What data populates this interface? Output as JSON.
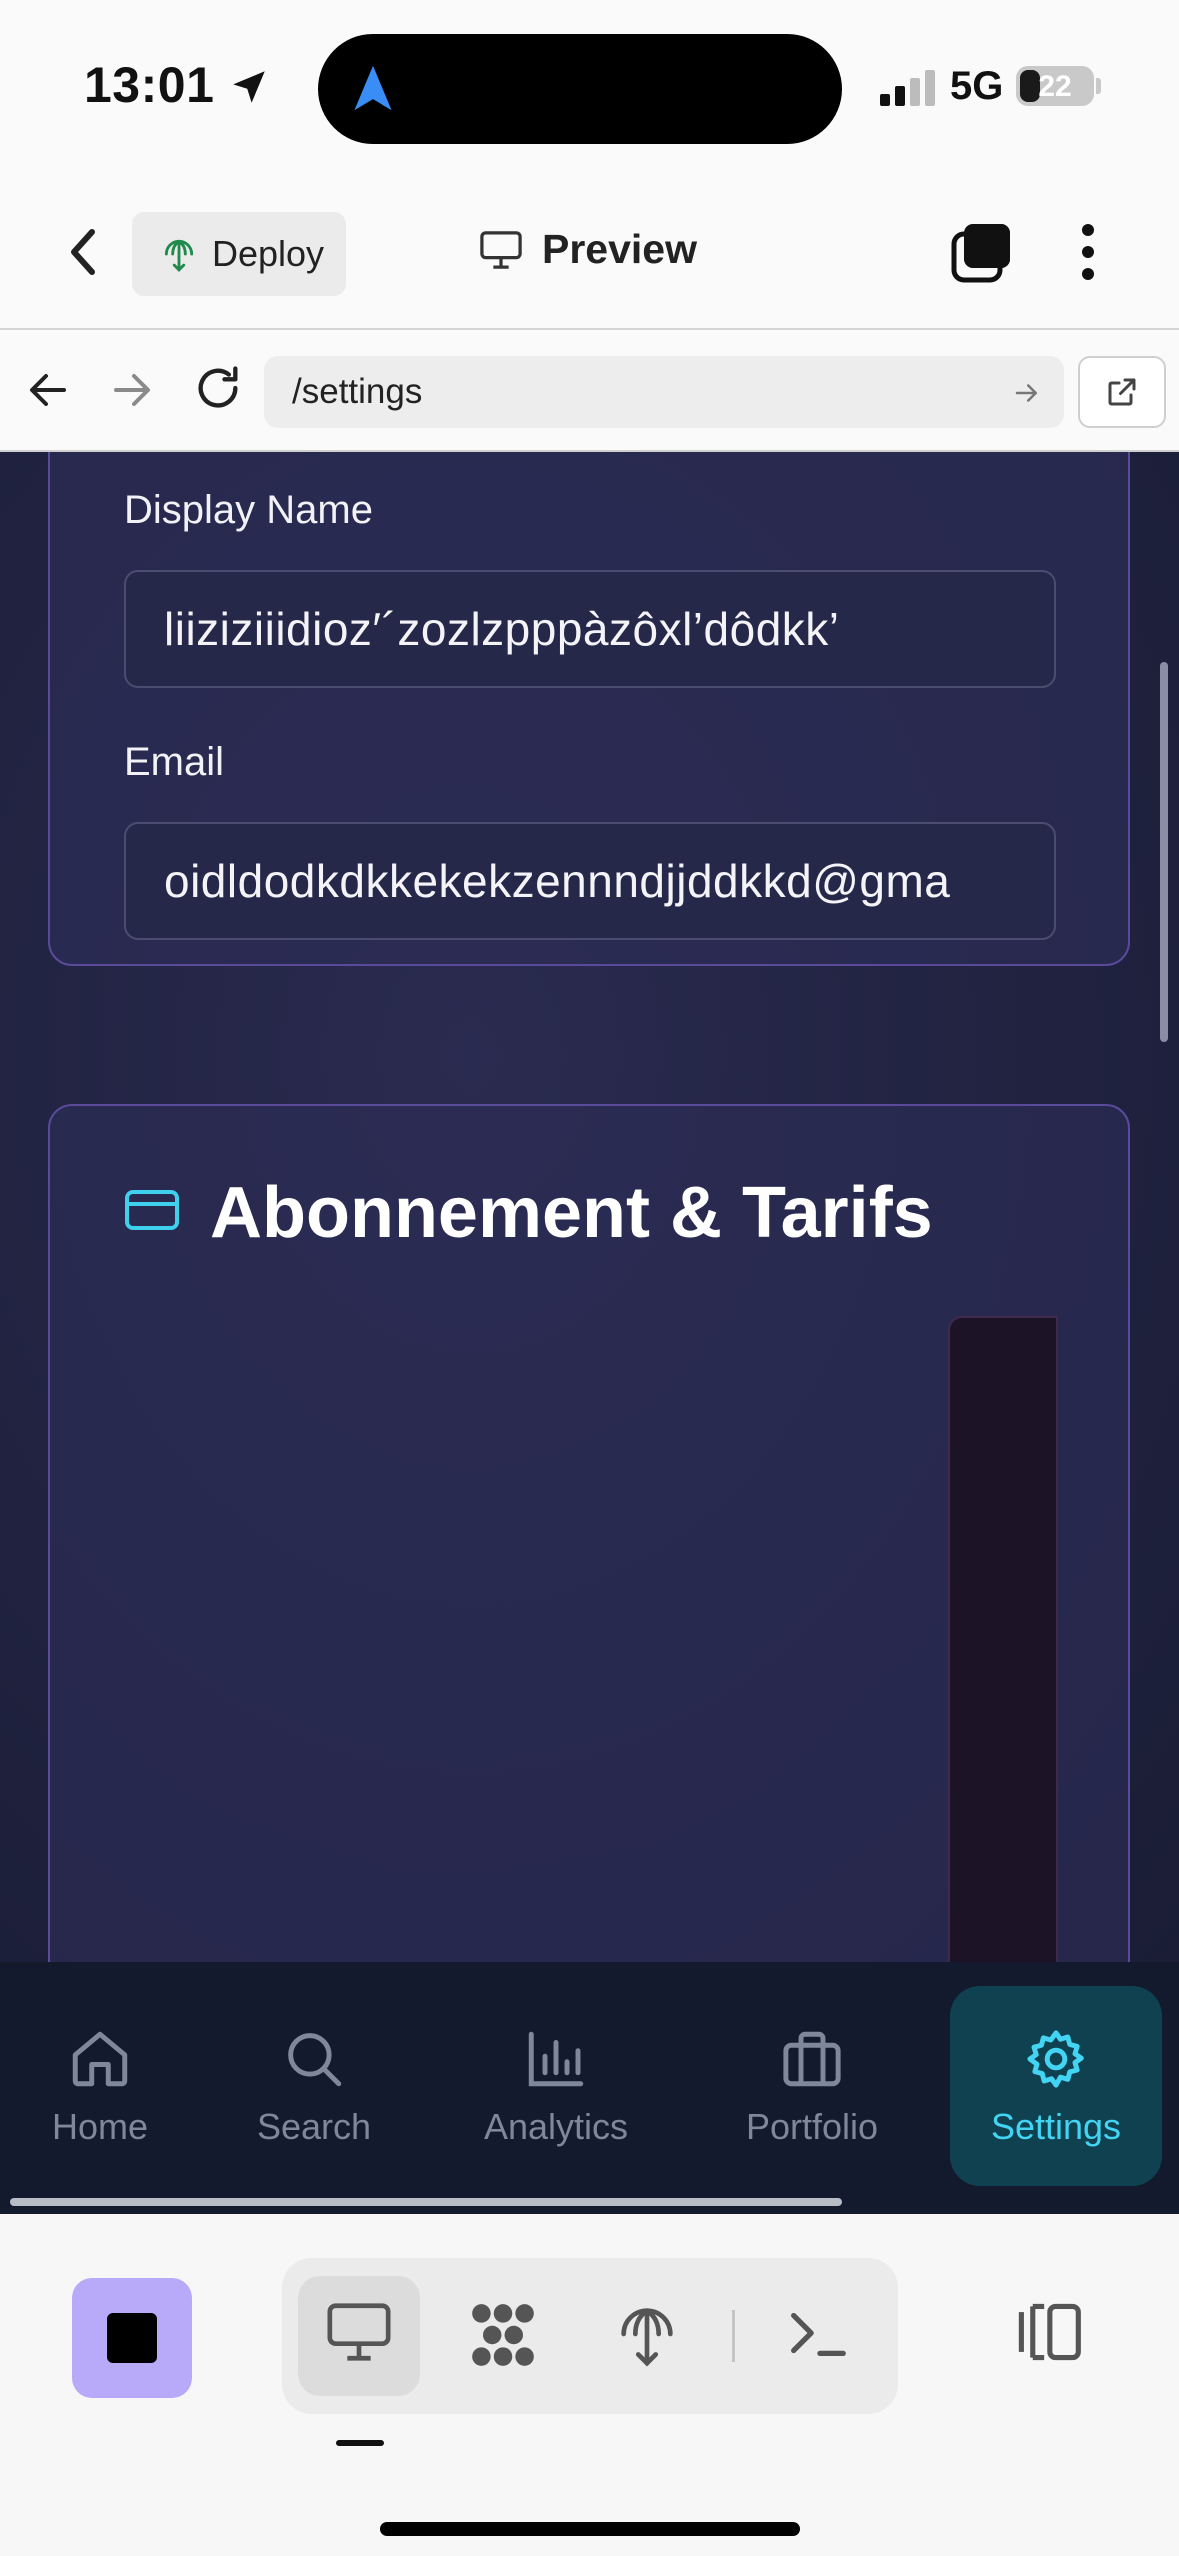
{
  "status_bar": {
    "time": "13:01",
    "network": "5G",
    "battery": "22"
  },
  "header": {
    "deploy_label": "Deploy",
    "preview_label": "Preview"
  },
  "browser": {
    "url": "/settings"
  },
  "profile": {
    "display_name_label": "Display Name",
    "display_name_value": "liiziziiidioz′´zozlzpppàzôxl’dôdkk’",
    "email_label": "Email",
    "email_value": "oidldodkdkkekekzennndjjddkkd@gma"
  },
  "subscription": {
    "title": "Abonnement & Tarifs"
  },
  "bottom_nav": {
    "items": [
      {
        "label": "Home",
        "icon": "home-icon"
      },
      {
        "label": "Search",
        "icon": "search-icon"
      },
      {
        "label": "Analytics",
        "icon": "bar-chart-icon"
      },
      {
        "label": "Portfolio",
        "icon": "briefcase-icon"
      },
      {
        "label": "Settings",
        "icon": "gear-icon",
        "active": true
      }
    ]
  },
  "colors": {
    "accent": "#42d4f2",
    "card_border": "#5a4a9a",
    "content_bg": "#222443",
    "nav_bg": "#131a2e",
    "stop_button": "#b8a9f9"
  }
}
